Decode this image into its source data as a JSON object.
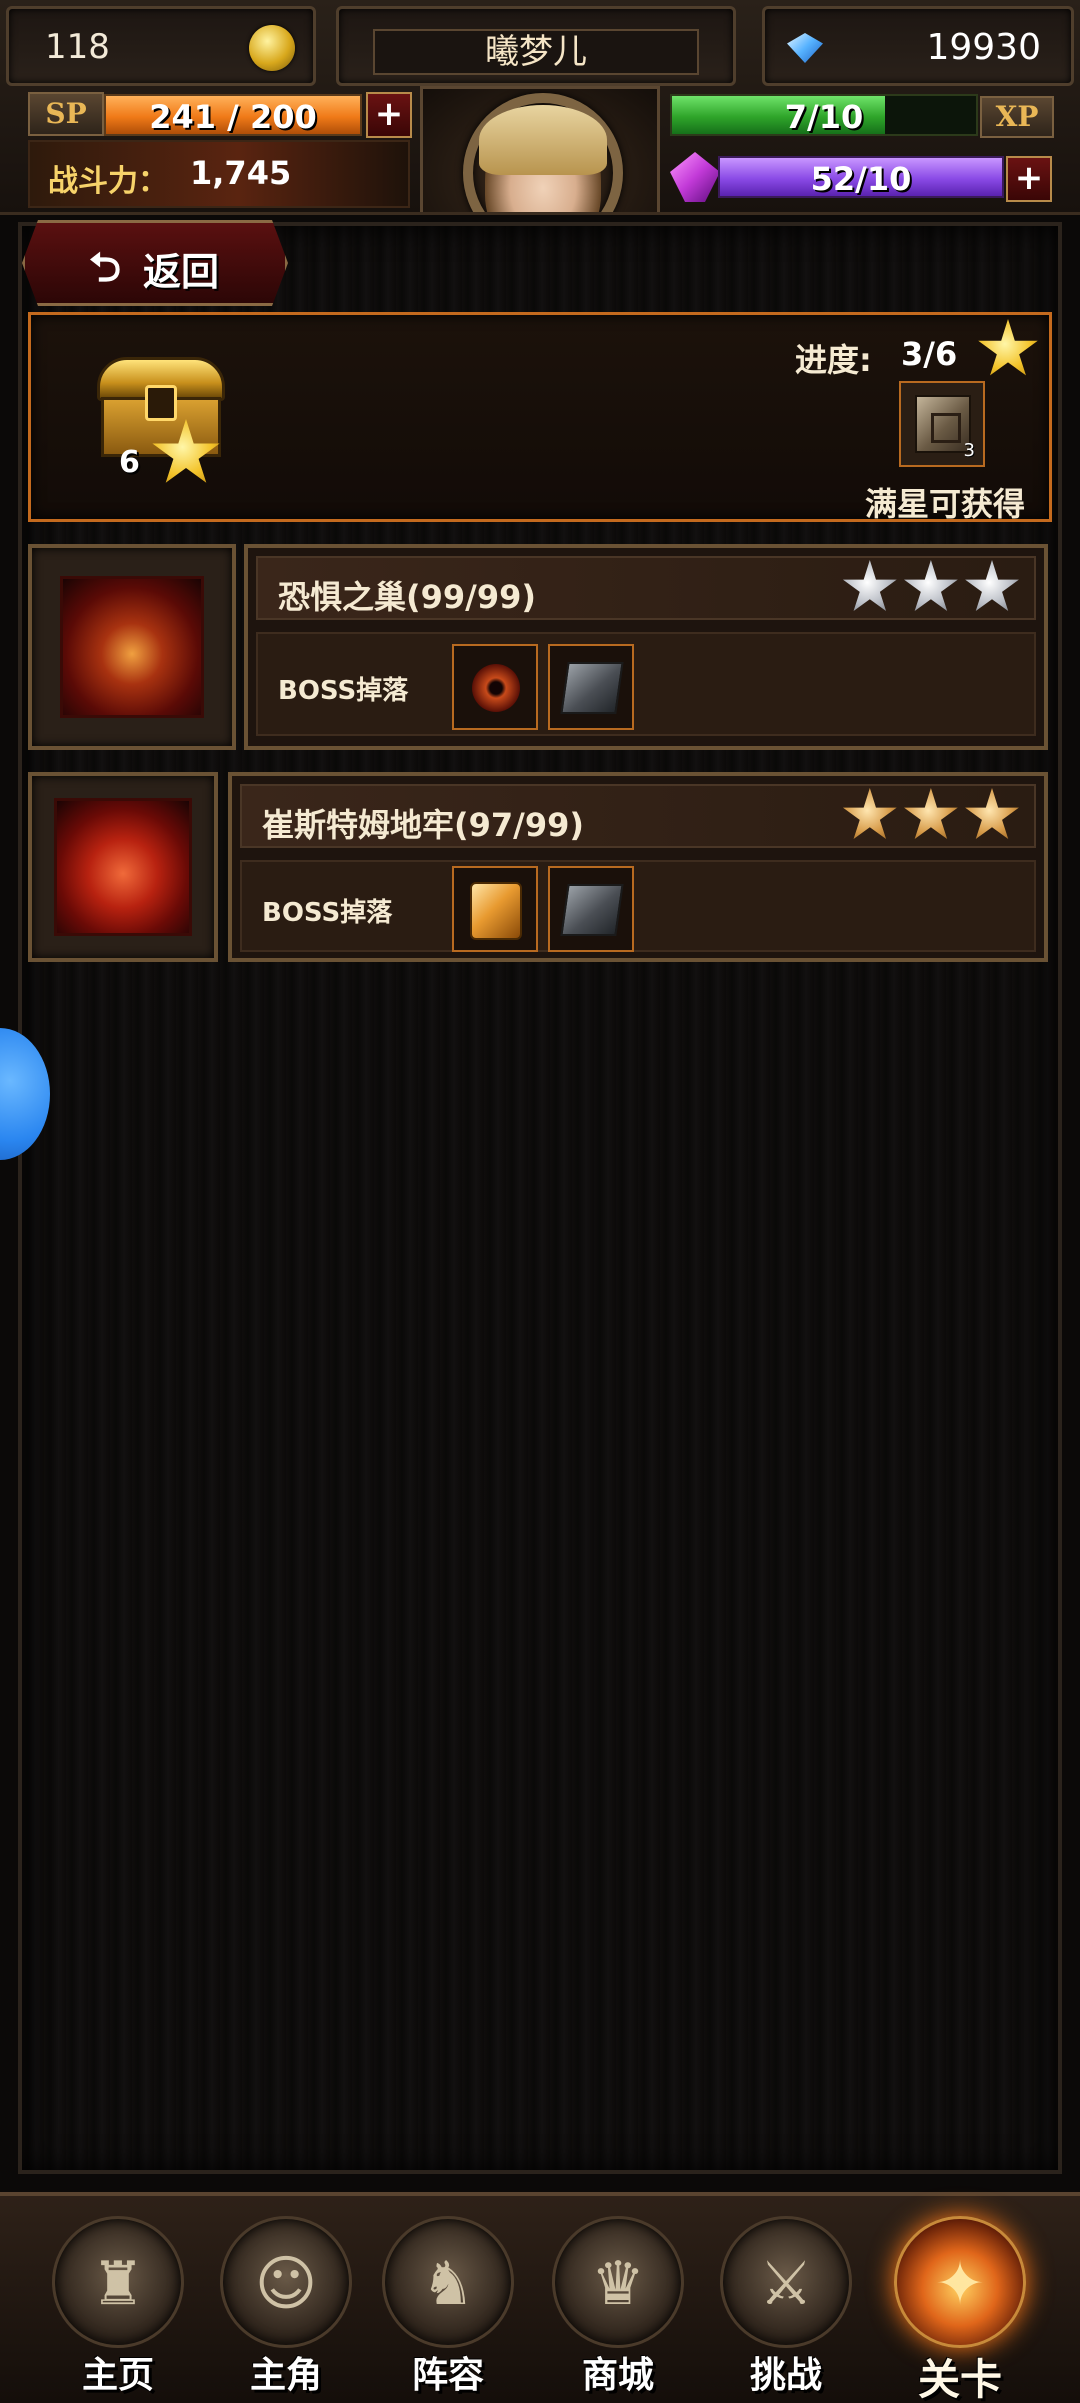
{
  "header": {
    "level": "118",
    "player_name": "曦梦儿",
    "gems": "19930",
    "sp_label": "SP",
    "sp_text": "241 / 200",
    "sp_fill": 1.0,
    "power_label": "战斗力：",
    "power_value": "1,745",
    "xp_label": "XP",
    "xp_text": "7/10",
    "xp_fill": 0.7,
    "mana_text": "52/10",
    "mana_fill": 1.0,
    "plus": "+"
  },
  "back": {
    "arrow": "⮌",
    "label": "返回"
  },
  "reward": {
    "chest_stars": "6",
    "progress_label": "进度:",
    "progress_value": "3/6",
    "item_count": "3",
    "full_star_label": "满星可获得"
  },
  "dungeons": [
    {
      "title": "恐惧之巢(99/99)",
      "drop_label": "BOSS掉落",
      "stars_earned": 0,
      "stars_total": 3,
      "star_color": "silver"
    },
    {
      "title": "崔斯特姆地牢(97/99)",
      "drop_label": "BOSS掉落",
      "stars_earned": 3,
      "stars_total": 3,
      "star_color": "bronze"
    }
  ],
  "nav": [
    {
      "label": "主页",
      "icon": "castle-icon",
      "active": false
    },
    {
      "label": "主角",
      "icon": "hero-icon",
      "active": false
    },
    {
      "label": "阵容",
      "icon": "helmet-icon",
      "active": false
    },
    {
      "label": "商城",
      "icon": "treasure-chest-icon",
      "active": false
    },
    {
      "label": "挑战",
      "icon": "crossed-axes-icon",
      "active": false
    },
    {
      "label": "关卡",
      "icon": "stage-flame-icon",
      "active": true
    }
  ],
  "colors": {
    "sp": "#f07a18",
    "xp": "#2fa52a",
    "mana": "#8a4ae6",
    "accent": "#c46a1e"
  }
}
